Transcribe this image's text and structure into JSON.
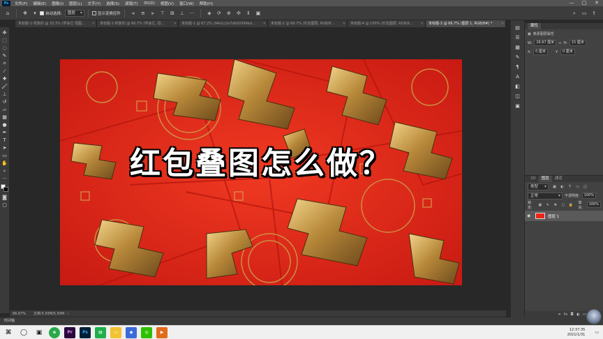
{
  "app": {
    "logo_text": "Ps",
    "menu": [
      "文件(F)",
      "编辑(E)",
      "图像(I)",
      "图层(L)",
      "文字(Y)",
      "选择(S)",
      "滤镜(T)",
      "3D(D)",
      "视图(V)",
      "窗口(W)",
      "帮助(H)"
    ],
    "window_controls": [
      "—",
      "□",
      "✕"
    ]
  },
  "options_bar": {
    "auto_select_label": "自动选择:",
    "auto_select_value": "图层",
    "show_transform_label": "显示变换控件"
  },
  "tabs": [
    {
      "label": "未标题-1-恢复的 @ 33.3% (学会它 招图…",
      "active": false
    },
    {
      "label": "未标题-1-恢复的 @ 66.7% (学会它, 招…",
      "active": false
    },
    {
      "label": "未标题-1 @ 67.2% (94e1c2a7db02049ed…",
      "active": false
    },
    {
      "label": "未标题-2 @ 66.7% (红包图层, RGB/8…",
      "active": false
    },
    {
      "label": "未标题-4 @ 100% (红包图层, RGB/8…",
      "active": false
    },
    {
      "label": "未标题-3 @ 66.7% (图层 1, RGB/8#) *",
      "active": true
    }
  ],
  "canvas": {
    "headline": "红包叠图怎么做？",
    "background_color": "#e8261a",
    "gold_color": "#c9a24a"
  },
  "status_bar": {
    "zoom": "66.67%",
    "doc_info": "文档:5.93M/5.93M"
  },
  "timeline_label": "时间轴",
  "properties_panel": {
    "title": "属性",
    "subtitle": "像素图层属性",
    "w_label": "W:",
    "w_value": "26.67 厘米",
    "h_label": "H:",
    "h_value": "15 厘米",
    "x_label": "X:",
    "x_value": "0 厘米",
    "y_label": "Y:",
    "y_value": "0 厘米"
  },
  "layers_panel": {
    "tabs": [
      "3D",
      "图层",
      "通道"
    ],
    "active_tab": "图层",
    "filter_label": "类型",
    "blend_mode": "正常",
    "opacity_label": "不透明度:",
    "opacity_value": "100%",
    "lock_label": "锁定:",
    "fill_label": "填充:",
    "fill_value": "100%",
    "layers": [
      {
        "name": "图层 1",
        "visible": true
      }
    ]
  },
  "taskbar": {
    "time": "12:37:35",
    "date": "2021/1/31"
  }
}
